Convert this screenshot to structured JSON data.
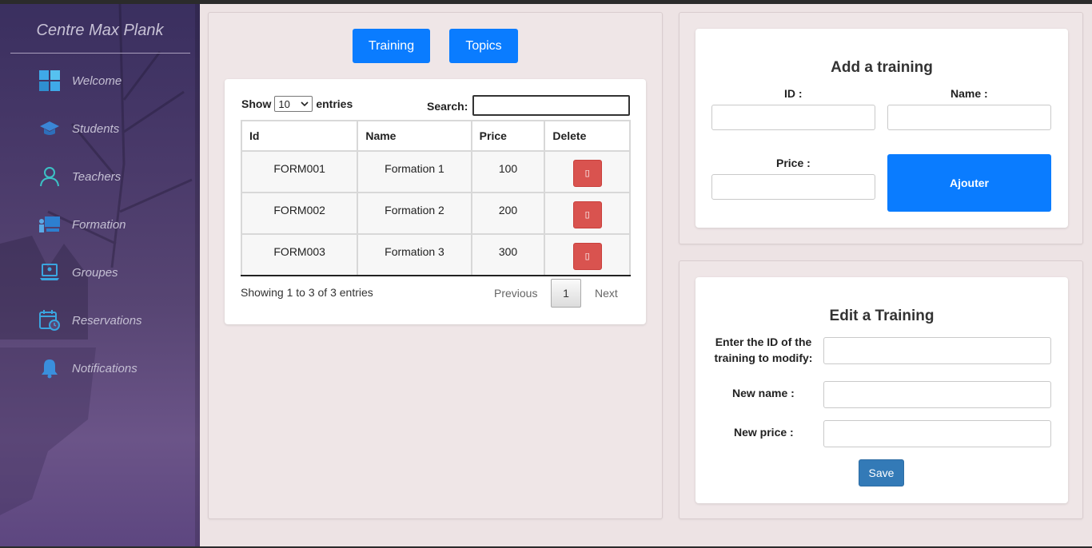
{
  "sidebar": {
    "brand": "Centre Max Plank",
    "items": [
      {
        "label": "Welcome",
        "icon": "dashboard-grid-icon"
      },
      {
        "label": "Students",
        "icon": "graduation-cap-icon"
      },
      {
        "label": "Teachers",
        "icon": "teacher-icon"
      },
      {
        "label": "Formation",
        "icon": "training-board-icon"
      },
      {
        "label": "Groupes",
        "icon": "laptop-user-icon"
      },
      {
        "label": "Reservations",
        "icon": "calendar-clock-icon"
      },
      {
        "label": "Notifications",
        "icon": "bell-icon"
      }
    ]
  },
  "main": {
    "tabs": [
      "Training",
      "Topics"
    ],
    "table": {
      "show_label": "Show",
      "entries_label": "entries",
      "page_size": "10",
      "search_label": "Search:",
      "columns": [
        "Id",
        "Name",
        "Price",
        "Delete"
      ],
      "rows": [
        {
          "id": "FORM001",
          "name": "Formation 1",
          "price": "100"
        },
        {
          "id": "FORM002",
          "name": "Formation 2",
          "price": "200"
        },
        {
          "id": "FORM003",
          "name": "Formation 3",
          "price": "300"
        }
      ],
      "delete_glyph": "▯",
      "info": "Showing 1 to 3 of 3 entries",
      "prev": "Previous",
      "page": "1",
      "next": "Next"
    }
  },
  "add_form": {
    "title": "Add a training",
    "id_label": "ID :",
    "name_label": "Name :",
    "price_label": "Price :",
    "submit": "Ajouter"
  },
  "edit_form": {
    "title": "Edit a Training",
    "id_label_1": "Enter the ID of the",
    "id_label_2": "training to modify:",
    "name_label": "New name :",
    "price_label": "New price :",
    "save": "Save"
  },
  "colors": {
    "accent": "#0a7cff",
    "danger": "#d9534f",
    "save": "#337ab7",
    "sidebar": "#4a3a6a"
  }
}
